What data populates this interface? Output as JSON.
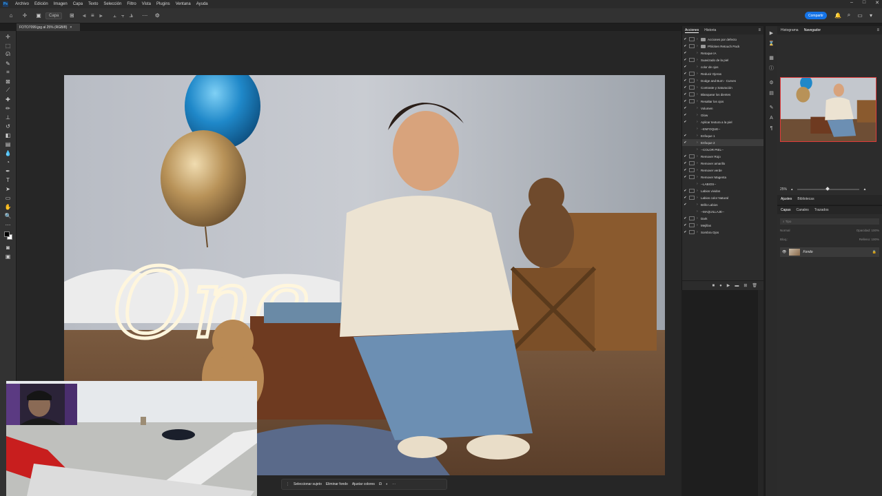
{
  "menubar": {
    "app_logo": "Ps",
    "items": [
      "Archivo",
      "Edición",
      "Imagen",
      "Capa",
      "Texto",
      "Selección",
      "Filtro",
      "Vista",
      "Plugins",
      "Ventana",
      "Ayuda"
    ],
    "window_controls": [
      "–",
      "□",
      "✕"
    ]
  },
  "optbar": {
    "layer_select": "Capa",
    "share_label": "Compartir"
  },
  "document": {
    "tab_title": "FOTO7099.jpg al 25% (RGB/8)",
    "close": "×"
  },
  "taskbar": {
    "select_subject": "Seleccionar sujeto",
    "remove_bg": "Eliminar fondo",
    "adjust_colors": "Ajustar colores"
  },
  "actions_panel": {
    "tabs": [
      "Acciones",
      "Historia"
    ],
    "rows": [
      {
        "label": "Acciones por defecto",
        "folder": true,
        "check": true,
        "dlg": true
      },
      {
        "label": "Phlicken Retouch Pack",
        "folder": true,
        "check": true,
        "dlg": true
      },
      {
        "label": "Retoque IA",
        "check": true,
        "dlg": false
      },
      {
        "label": "Suavizado de la piel",
        "check": true,
        "dlg": true
      },
      {
        "label": "color de ojos",
        "check": true,
        "dlg": false
      },
      {
        "label": "Reducir Ojeras",
        "check": true,
        "dlg": true
      },
      {
        "label": "Dodge and Burn - Curves",
        "check": true,
        "dlg": true
      },
      {
        "label": "Contraste y Saturación",
        "check": true,
        "dlg": true
      },
      {
        "label": "Blanquear los dientes",
        "check": true,
        "dlg": true
      },
      {
        "label": "Resaltar los ojos",
        "check": true,
        "dlg": true
      },
      {
        "label": "Volumen",
        "check": true,
        "dlg": false
      },
      {
        "label": "Glow",
        "check": true,
        "dlg": false
      },
      {
        "label": "Aplicar textura a la piel",
        "check": true,
        "dlg": false
      },
      {
        "label": "--ENFOQUE--",
        "check": false,
        "dlg": false
      },
      {
        "label": "Enfoque 1",
        "check": true,
        "dlg": false
      },
      {
        "label": "Enfoque 2",
        "check": true,
        "dlg": false,
        "highlight": true
      },
      {
        "label": "--COLOR PIEL--",
        "check": false,
        "dlg": false
      },
      {
        "label": "Remover Rojo",
        "check": true,
        "dlg": true
      },
      {
        "label": "Remover amarillo",
        "check": true,
        "dlg": true
      },
      {
        "label": "Remover verde",
        "check": true,
        "dlg": true
      },
      {
        "label": "Remover Magenta",
        "check": true,
        "dlg": true
      },
      {
        "label": "--LABIOS--",
        "check": false,
        "dlg": false
      },
      {
        "label": "Labios vividos",
        "check": true,
        "dlg": true
      },
      {
        "label": "Labios color Natural",
        "check": true,
        "dlg": true
      },
      {
        "label": "Brillo Labios",
        "check": true,
        "dlg": false
      },
      {
        "label": "--MAQUILLAJE--",
        "check": false,
        "dlg": false
      },
      {
        "label": "Dark",
        "check": true,
        "dlg": true
      },
      {
        "label": "Mejillas",
        "check": true,
        "dlg": true
      },
      {
        "label": "Sombra Ojos",
        "check": true,
        "dlg": true
      }
    ]
  },
  "nav_panel": {
    "tabs": [
      "Histograma",
      "Navegador"
    ],
    "zoom": "25%"
  },
  "adj_panel": {
    "tabs": [
      "Ajustes",
      "Bibliotecas"
    ]
  },
  "layers_panel": {
    "tabs": [
      "Capas",
      "Canales",
      "Trazados"
    ],
    "search_placeholder": "Tipo",
    "blend_mode": "Normal",
    "opacity_label": "Opacidad:",
    "opacity_value": "100%",
    "lock_label": "Bloq.:",
    "fill_label": "Relleno:",
    "fill_value": "100%",
    "layer_name": "Fondo"
  }
}
